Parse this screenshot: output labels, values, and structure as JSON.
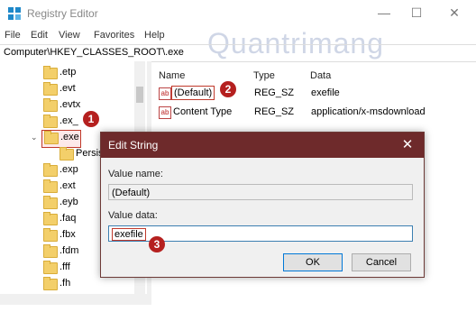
{
  "window": {
    "title": "Registry Editor",
    "minimize_glyph": "—",
    "maximize_glyph": "☐",
    "close_glyph": "✕"
  },
  "menu": [
    "File",
    "Edit",
    "View",
    "Favorites",
    "Help"
  ],
  "address": "Computer\\HKEY_CLASSES_ROOT\\.exe",
  "tree": {
    "items": [
      ".etp",
      ".evt",
      ".evtx",
      ".ex_",
      ".exe",
      "Persis",
      ".exp",
      ".ext",
      ".eyb",
      ".faq",
      ".fbx",
      ".fdm",
      ".fff",
      ".fh"
    ]
  },
  "list": {
    "columns": [
      "Name",
      "Type",
      "Data"
    ],
    "rows": [
      {
        "name": "(Default)",
        "type": "REG_SZ",
        "data": "exefile"
      },
      {
        "name": "Content Type",
        "type": "REG_SZ",
        "data": "application/x-msdownload"
      }
    ],
    "icon_glyph": "ab"
  },
  "dialog": {
    "title": "Edit String",
    "value_name_label": "Value name:",
    "value_name": "(Default)",
    "value_data_label": "Value data:",
    "value_data": "exefile",
    "ok_label": "OK",
    "cancel_label": "Cancel",
    "close_glyph": "✕"
  },
  "badges": [
    "1",
    "2",
    "3"
  ],
  "watermark": "Quantrimang",
  "colors": {
    "accent": "#6e2a2b",
    "badge": "#b5201f",
    "folder": "#f3cf6a"
  }
}
